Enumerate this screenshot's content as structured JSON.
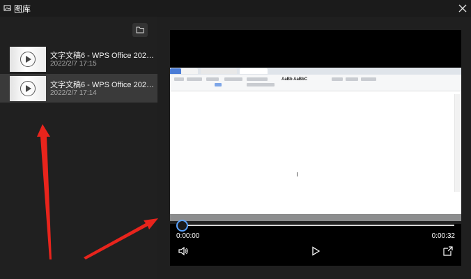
{
  "window": {
    "title": "图库"
  },
  "sidebar": {
    "items": [
      {
        "title": "文字文稿6 - WPS Office 202…",
        "date": "2022/2/7 17:15",
        "selected": false
      },
      {
        "title": "文字文稿6 - WPS Office 202…",
        "date": "2022/2/7 17:14",
        "selected": true
      }
    ]
  },
  "player": {
    "current_time": "0:00:00",
    "duration": "0:00:32",
    "progress_fraction": 0.0
  },
  "colors": {
    "accent": "#5aa2ff",
    "annotation": "#e8241c"
  },
  "icons": {
    "app": "gallery-icon",
    "close": "close-icon",
    "folder": "folder-icon",
    "play": "play-icon",
    "volume": "volume-icon",
    "expand": "expand-icon"
  }
}
